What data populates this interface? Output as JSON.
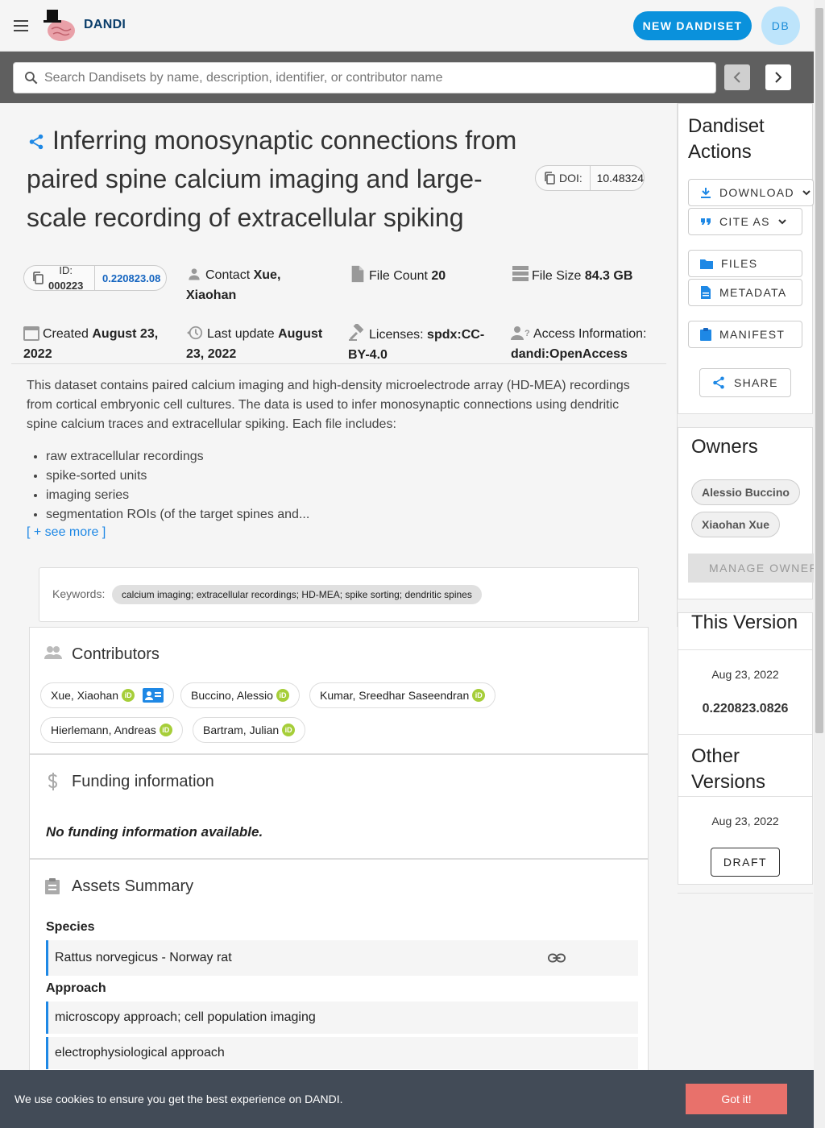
{
  "header": {
    "brand": "DANDI",
    "new_dandiset": "NEW DANDISET",
    "avatar_initials": "DB"
  },
  "search": {
    "placeholder": "Search Dandisets by name, description, identifier, or contributor name"
  },
  "dandiset": {
    "title": "Inferring monosynaptic connections from paired spine calcium imaging and large-scale recording of extracellular spiking",
    "doi_label": "DOI:",
    "doi_value": "10.48324",
    "id_label_1": "ID:",
    "id_label_2": "000223",
    "id_version": "0.220823.08",
    "contact_label": "Contact",
    "contact_value": "Xue, Xiaohan",
    "file_count_label": "File Count",
    "file_count_value": "20",
    "file_size_label": "File Size",
    "file_size_value": "84.3 GB",
    "created_label": "Created",
    "created_value": "August 23, 2022",
    "updated_label": "Last update",
    "updated_value": "August 23, 2022",
    "license_label": "Licenses:",
    "license_value": "spdx:CC-BY-4.0",
    "access_label": "Access Information:",
    "access_value": "dandi:OpenAccess",
    "description": "This dataset contains paired calcium imaging and high-density microelectrode array (HD-MEA) recordings from cortical embryonic cell cultures. The data is used to infer monosynaptic connections using dendritic spine calcium traces and extracellular spiking. Each file includes:",
    "bullets": [
      "raw extracellular recordings",
      "spike-sorted units",
      "imaging series",
      "segmentation ROIs (of the target spines and..."
    ],
    "see_more": "[ + see more ]",
    "keywords_label": "Keywords:",
    "keywords": "calcium imaging; extracellular recordings; HD-MEA; spike sorting; dendritic spines"
  },
  "contributors": {
    "title": "Contributors",
    "people": [
      "Xue, Xiaohan",
      "Buccino, Alessio",
      "Kumar, Sreedhar Saseendran",
      "Hierlemann, Andreas",
      "Bartram, Julian"
    ]
  },
  "funding": {
    "title": "Funding information",
    "empty": "No funding information available."
  },
  "assets": {
    "title": "Assets Summary",
    "species_label": "Species",
    "species": [
      "Rattus norvegicus - Norway rat"
    ],
    "approach_label": "Approach",
    "approaches": [
      "microscopy approach; cell population imaging",
      "electrophysiological approach"
    ]
  },
  "actions": {
    "title": "Dandiset Actions",
    "download": "DOWNLOAD",
    "cite_as": "CITE AS",
    "files": "FILES",
    "metadata": "METADATA",
    "manifest": "MANIFEST",
    "share": "SHARE"
  },
  "owners": {
    "title": "Owners",
    "people": [
      "Alessio Buccino",
      "Xiaohan Xue"
    ],
    "manage": "MANAGE OWNERS"
  },
  "this_version": {
    "title": "This Version",
    "date": "Aug 23, 2022",
    "version": "0.220823.0826"
  },
  "other_versions": {
    "title": "Other Versions",
    "date": "Aug 23, 2022",
    "draft": "DRAFT"
  },
  "cookie": {
    "text": "We use cookies to ensure you get the best experience on DANDI.",
    "button": "Got it!"
  },
  "colors": {
    "primary": "#0a91dc",
    "link": "#1565c0",
    "cookie_bg": "#424b57",
    "cookie_button": "#e8716b",
    "orcid": "#a6ce39"
  }
}
